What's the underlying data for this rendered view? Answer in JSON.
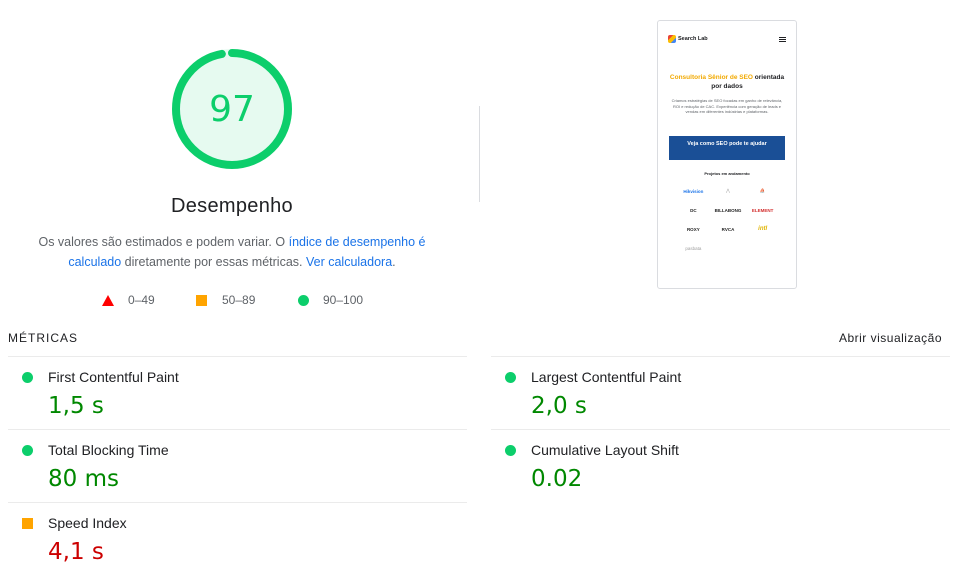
{
  "score": {
    "value": "97",
    "fraction": 0.97,
    "title": "Desempenho",
    "color": "#0cce6b"
  },
  "description": {
    "part1": "Os valores são estimados e podem variar. O ",
    "link1": "índice de desempenho é calculado",
    "part2": " diretamente por essas métricas. ",
    "link2": "Ver calculadora",
    "part3": "."
  },
  "legend": [
    {
      "label": "0–49",
      "shape": "triangle",
      "color": "#ff0000"
    },
    {
      "label": "50–89",
      "shape": "square",
      "color": "#ffa400"
    },
    {
      "label": "90–100",
      "shape": "circle",
      "color": "#0cce6b"
    }
  ],
  "screenshot": {
    "brand": "Search Lab",
    "hero_accent": "Consultoria Sênior de SEO",
    "hero_rest": " orientada por dados",
    "subtitle": "Criamos estratégias de SEO focadas em ganho de relevância, ROI e redução de CAC. Experiência com geração de leads e vendas em diferentes indústrias e plataformas.",
    "cta": "Veja como SEO pode te ajudar",
    "projects_label": "Projetos em andamento",
    "logos": [
      "Hikvision",
      "",
      "",
      "DC",
      "BILLABONG",
      "ELEMENT",
      "ROXY",
      "RVCA",
      "intl",
      "pasbata"
    ]
  },
  "metrics_header": {
    "label": "MÉTRICAS",
    "toggle": "Abrir visualização"
  },
  "metrics": [
    {
      "name": "First Contentful Paint",
      "value": "1,5 s",
      "status": "pass"
    },
    {
      "name": "Largest Contentful Paint",
      "value": "2,0 s",
      "status": "pass"
    },
    {
      "name": "Total Blocking Time",
      "value": "80 ms",
      "status": "pass"
    },
    {
      "name": "Cumulative Layout Shift",
      "value": "0.02",
      "status": "pass"
    },
    {
      "name": "Speed Index",
      "value": "4,1 s",
      "status": "average"
    }
  ]
}
